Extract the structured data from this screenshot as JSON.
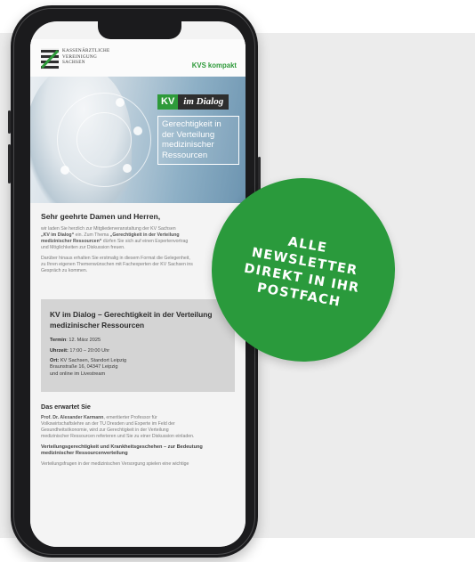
{
  "header": {
    "org_line1": "KASSENÄRZTLICHE",
    "org_line2": "VEREINIGUNG",
    "org_line3": "SACHSEN",
    "brand": "KVS kompakt"
  },
  "hero": {
    "badge_kv": "KV",
    "badge_dialog": "im Dialog",
    "topic": "Gerechtigkeit in der Verteilung medizinischer Ressourcen"
  },
  "mail": {
    "greeting": "Sehr geehrte Damen und Herren,",
    "intro_1": "wir laden Sie herzlich zur Mitgliederveranstaltung der KV Sachsen",
    "intro_2a": "„KV im Dialog“",
    "intro_2b": " ein. Zum Thema ",
    "intro_2c": "„Gerechtigkeit in der Verteilung",
    "intro_3a": "medizinischer Ressourcen“",
    "intro_3b": " dürfen Sie sich auf einen Expertenvortrag",
    "intro_4": "und Möglichkeiten zur Diskussion freuen.",
    "para2_1": "Darüber hinaus erhalten Sie erstmalig in diesem Format die Gelegenheit,",
    "para2_2": "zu Ihren eigenen Themenwünschen mit Fachexperten der KV Sachsen ins",
    "para2_3": "Gespräch zu kommen."
  },
  "event": {
    "title": "KV im Dialog – Gerechtigkeit in der Verteilung medizinischer Ressourcen",
    "termin_label": "Termin",
    "termin_value": ": 12. März 2025",
    "uhrzeit_label": "Uhrzeit:",
    "uhrzeit_value": " 17:00 – 20:00 Uhr",
    "ort_label": "Ort:",
    "ort_value": " KV Sachsen, Standort Leipzig",
    "ort_line2": "Braunstraße 16, 04347 Leipzig",
    "ort_line3": "und online im Livestream"
  },
  "expect": {
    "heading": "Das erwartet Sie",
    "speaker_name": "Prof. Dr. Alexander Karmann",
    "speaker_1": ", emeritierter Professor für",
    "speaker_2": "Volkswirtschaftslehre an der TU Dresden und Experte im Feld der",
    "speaker_3": "Gesundheitsökonomie, wird zur Gerechtigkeit in der Verteilung",
    "speaker_4": "medizinischer Ressourcen referieren und Sie zu einer Diskussion einladen.",
    "sub_heading": "Verteilungsgerechtigkeit und Krankheitsgeschehen – zur Bedeutung medizinischer Ressourcenverteilung",
    "last_line": "Verteilungsfragen in der medizinischen Versorgung spielen eine wichtige"
  },
  "badge": {
    "line1": "ALLE",
    "line2": "NEWSLETTER",
    "line3": "DIREKT IN IHR",
    "line4": "POSTFACH"
  },
  "colors": {
    "brand_green": "#2e9a3a",
    "badge_green": "#2a9a3c",
    "phone": "#1b1b1d"
  }
}
